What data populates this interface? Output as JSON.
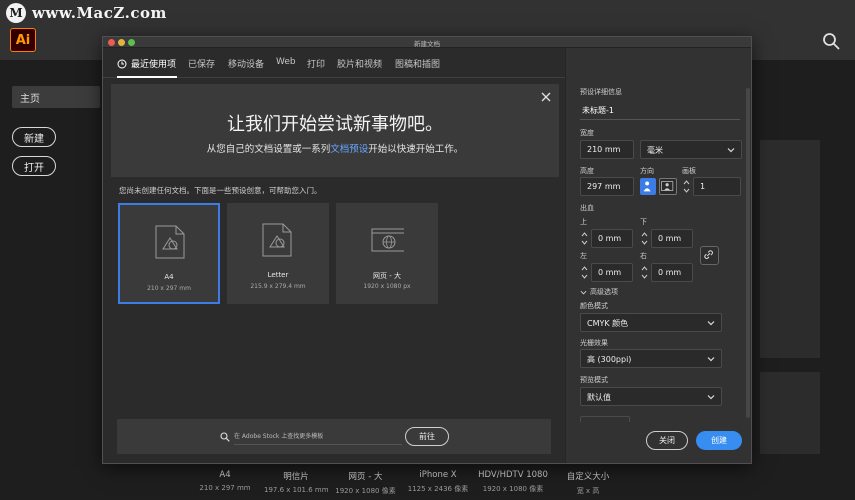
{
  "watermark": {
    "logo": "M",
    "text": "www.MacZ.com"
  },
  "app": {
    "logo": "Ai",
    "home_label": "主页",
    "new_label": "新建",
    "open_label": "打开",
    "bottom_presets": [
      {
        "name": "A4",
        "size": "210 x 297 mm"
      },
      {
        "name": "明信片",
        "size": "197.6 x 101.6 mm"
      },
      {
        "name": "网页 - 大",
        "size": "1920 x 1080 像素"
      },
      {
        "name": "iPhone X",
        "size": "1125 x 2436 像素"
      },
      {
        "name": "HDV/HDTV 1080",
        "size": "1920 x 1080 像素"
      },
      {
        "name": "自定义大小",
        "size": "宽 x 高"
      }
    ]
  },
  "dialog": {
    "title": "新建文档",
    "tabs": [
      {
        "label": "最近使用项"
      },
      {
        "label": "已保存"
      },
      {
        "label": "移动设备"
      },
      {
        "label": "Web"
      },
      {
        "label": "打印"
      },
      {
        "label": "胶片和视频"
      },
      {
        "label": "图稿和插图"
      }
    ],
    "hero": {
      "title": "让我们开始尝试新事物吧。",
      "sub_before": "从您自己的文档设置或一系列",
      "sub_link": "文档预设",
      "sub_after": "开始以快速开始工作。"
    },
    "hint": "您尚未创建任何文档。下面是一些预设创意，可帮助您入门。",
    "presets": [
      {
        "name": "A4",
        "size": "210 x 297 mm"
      },
      {
        "name": "Letter",
        "size": "215.9 x 279.4 mm"
      },
      {
        "name": "网页 - 大",
        "size": "1920 x 1080 px"
      }
    ],
    "stock": {
      "placeholder": "在 Adobe Stock 上查找更多模板",
      "go_label": "前往"
    }
  },
  "panel": {
    "section_title": "预设详细信息",
    "doc_name": "未标题-1",
    "width_label": "宽度",
    "width_value": "210 mm",
    "unit_value": "毫米",
    "height_label": "高度",
    "height_value": "297 mm",
    "orientation_label": "方向",
    "artboard_label": "画板",
    "artboard_value": "1",
    "bleed_label": "出血",
    "top_label": "上",
    "top_value": "0 mm",
    "bottom_label": "下",
    "bottom_value": "0 mm",
    "left_label": "左",
    "left_value": "0 mm",
    "right_label": "右",
    "right_value": "0 mm",
    "advanced_label": "高级选项",
    "color_mode_label": "颜色模式",
    "color_mode_value": "CMYK 颜色",
    "raster_label": "光栅效果",
    "raster_value": "高 (300ppi)",
    "preview_label": "预览模式",
    "preview_value": "默认值",
    "close_label": "关闭",
    "create_label": "创建"
  },
  "colors": {
    "accent": "#378ef0",
    "selection": "#3d7ce6",
    "link": "#67a6ff"
  }
}
